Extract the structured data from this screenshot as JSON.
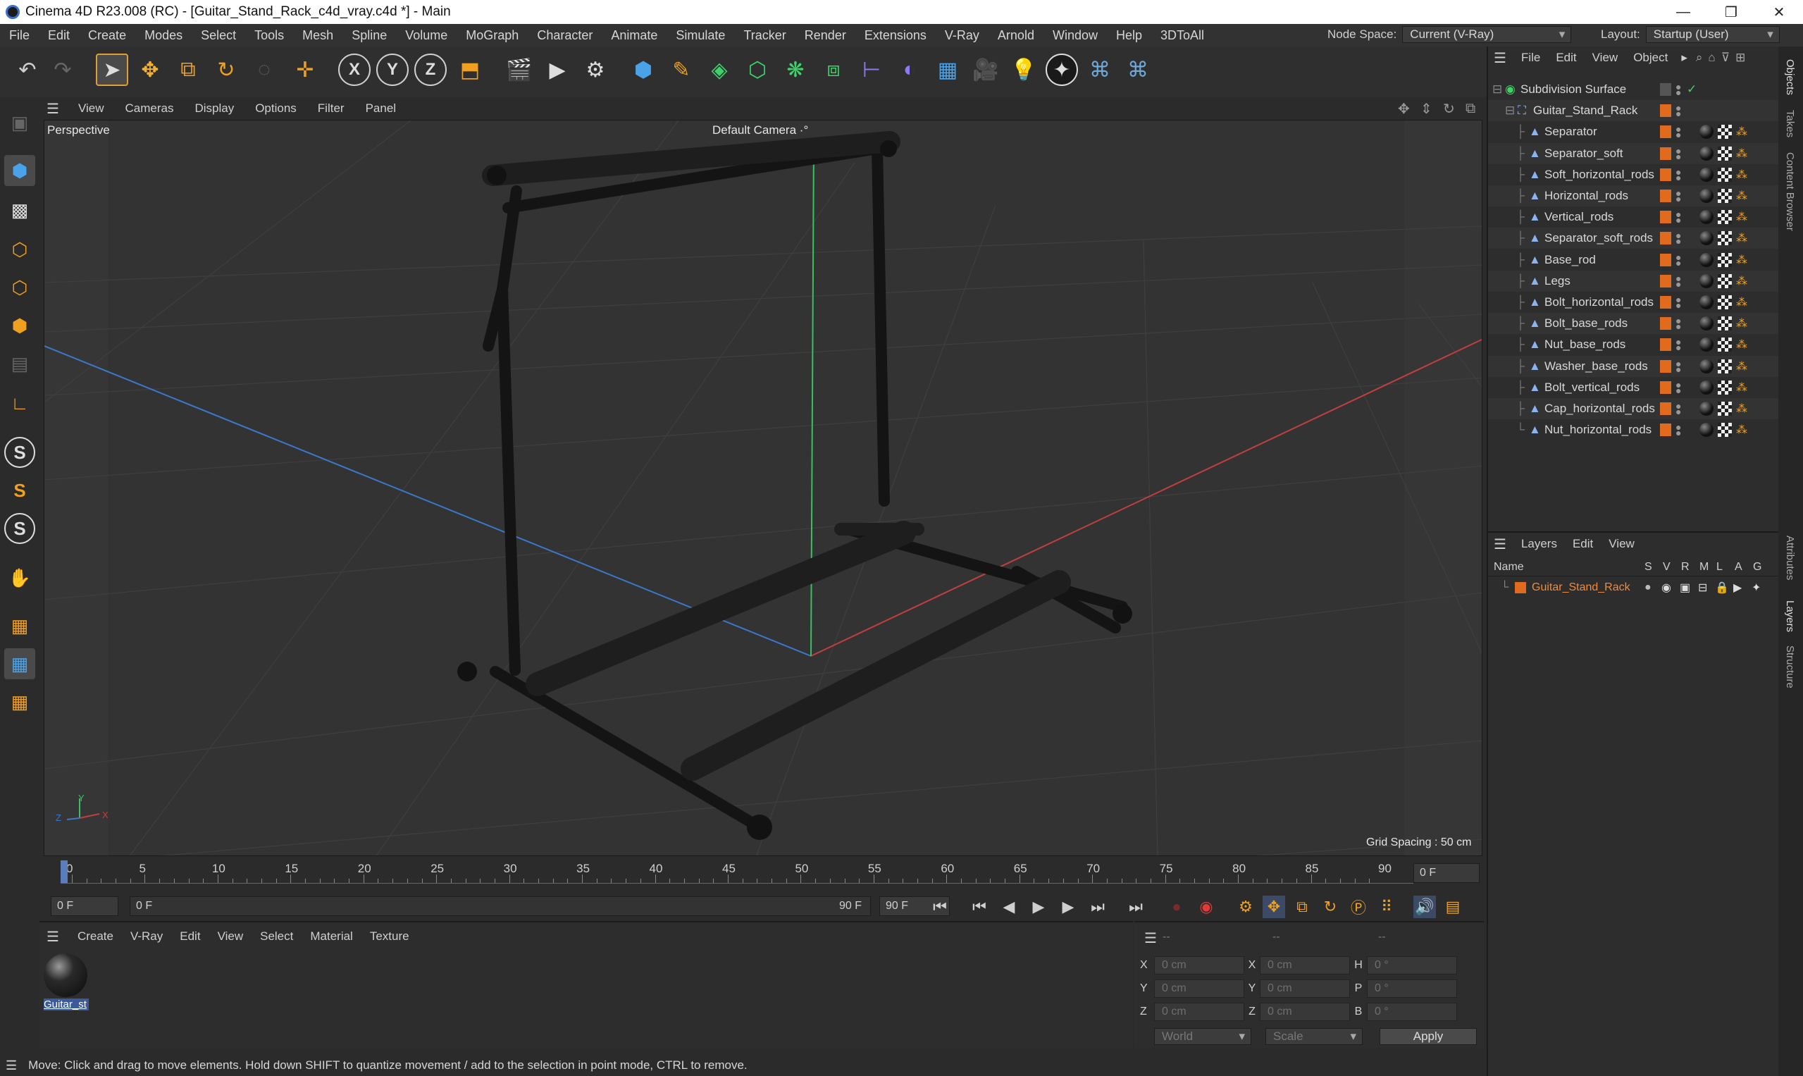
{
  "window": {
    "title": "Cinema 4D R23.008 (RC) - [Guitar_Stand_Rack_c4d_vray.c4d *] - Main",
    "minimize": "—",
    "maximize": "❐",
    "close": "✕"
  },
  "menubar": {
    "items": [
      "File",
      "Edit",
      "Create",
      "Modes",
      "Select",
      "Tools",
      "Mesh",
      "Spline",
      "Volume",
      "MoGraph",
      "Character",
      "Animate",
      "Simulate",
      "Tracker",
      "Render",
      "Extensions",
      "V-Ray",
      "Arnold",
      "Window",
      "Help",
      "3DToAll"
    ],
    "node_space_label": "Node Space:",
    "node_space_value": "Current (V-Ray)",
    "layout_label": "Layout:",
    "layout_value": "Startup (User)"
  },
  "toolbar": {
    "icons": [
      "undo-icon",
      "redo-icon",
      "select-arrow-icon",
      "move-icon",
      "scale-icon",
      "rotate-icon",
      "recent-tools-icon",
      "transform-icon",
      "x-axis-icon",
      "y-axis-icon",
      "z-axis-icon",
      "coordinate-system-icon",
      "render-view-icon",
      "render-picture-viewer-icon",
      "render-settings-icon",
      "cube-primitive-icon",
      "pen-spline-icon",
      "subdivision-icon",
      "extrude-icon",
      "cloner-icon",
      "boolean-icon",
      "symmetry-icon",
      "deformer-icon",
      "floor-icon",
      "camera-icon",
      "light-icon",
      "vray-icon",
      "python-icon",
      "python-script-icon"
    ],
    "x_label": "X",
    "y_label": "Y",
    "z_label": "Z"
  },
  "viewport": {
    "menu": [
      "View",
      "Cameras",
      "Display",
      "Options",
      "Filter",
      "Panel"
    ],
    "view_name": "Perspective",
    "camera_name": "Default Camera",
    "camera_suffix": "·°",
    "grid_spacing": "Grid Spacing : 50 cm",
    "axis_labels": {
      "x": "X",
      "y": "Y",
      "z": "Z"
    }
  },
  "timeline": {
    "ticks": [
      "0",
      "5",
      "10",
      "15",
      "20",
      "25",
      "30",
      "35",
      "40",
      "45",
      "50",
      "55",
      "60",
      "65",
      "70",
      "75",
      "80",
      "85",
      "90"
    ],
    "current_frame_field": "0 F",
    "start_field": "0 F",
    "range_start": "0 F",
    "range_end": "90 F",
    "end_field": "90 F"
  },
  "material_panel": {
    "menu": [
      "Create",
      "V-Ray",
      "Edit",
      "View",
      "Select",
      "Material",
      "Texture"
    ],
    "material_label": "Guitar_st"
  },
  "coordinates": {
    "header_dashes": [
      "--",
      "--",
      "--"
    ],
    "rows": [
      {
        "axis": "X",
        "pos": "0 cm",
        "axis2": "X",
        "size": "0 cm",
        "rot_label": "H",
        "rot": "0 °"
      },
      {
        "axis": "Y",
        "pos": "0 cm",
        "axis2": "Y",
        "size": "0 cm",
        "rot_label": "P",
        "rot": "0 °"
      },
      {
        "axis": "Z",
        "pos": "0 cm",
        "axis2": "Z",
        "size": "0 cm",
        "rot_label": "B",
        "rot": "0 °"
      }
    ],
    "mode_world": "World",
    "mode_scale": "Scale",
    "apply_label": "Apply"
  },
  "status": {
    "text": "Move: Click and drag to move elements. Hold down SHIFT to quantize movement / add to the selection in point mode, CTRL to remove."
  },
  "objects_panel": {
    "menu": [
      "File",
      "Edit",
      "View",
      "Object"
    ],
    "root": "Subdivision Surface",
    "group": "Guitar_Stand_Rack",
    "children": [
      "Separator",
      "Separator_soft",
      "Soft_horizontal_rods",
      "Horizontal_rods",
      "Vertical_rods",
      "Separator_soft_rods",
      "Base_rod",
      "Legs",
      "Bolt_horizontal_rods",
      "Bolt_base_rods",
      "Nut_base_rods",
      "Washer_base_rods",
      "Bolt_vertical_rods",
      "Cap_horizontal_rods",
      "Nut_horizontal_rods"
    ],
    "layer_color": "#e06a1e"
  },
  "layers_panel": {
    "menu": [
      "Layers",
      "Edit",
      "View"
    ],
    "name_header": "Name",
    "flag_headers": [
      "S",
      "V",
      "R",
      "M",
      "L",
      "A",
      "G"
    ],
    "layer_name": "Guitar_Stand_Rack"
  },
  "side_tabs": [
    "Objects",
    "Takes",
    "Content Browser",
    "Attributes",
    "Layers",
    "Structure"
  ]
}
